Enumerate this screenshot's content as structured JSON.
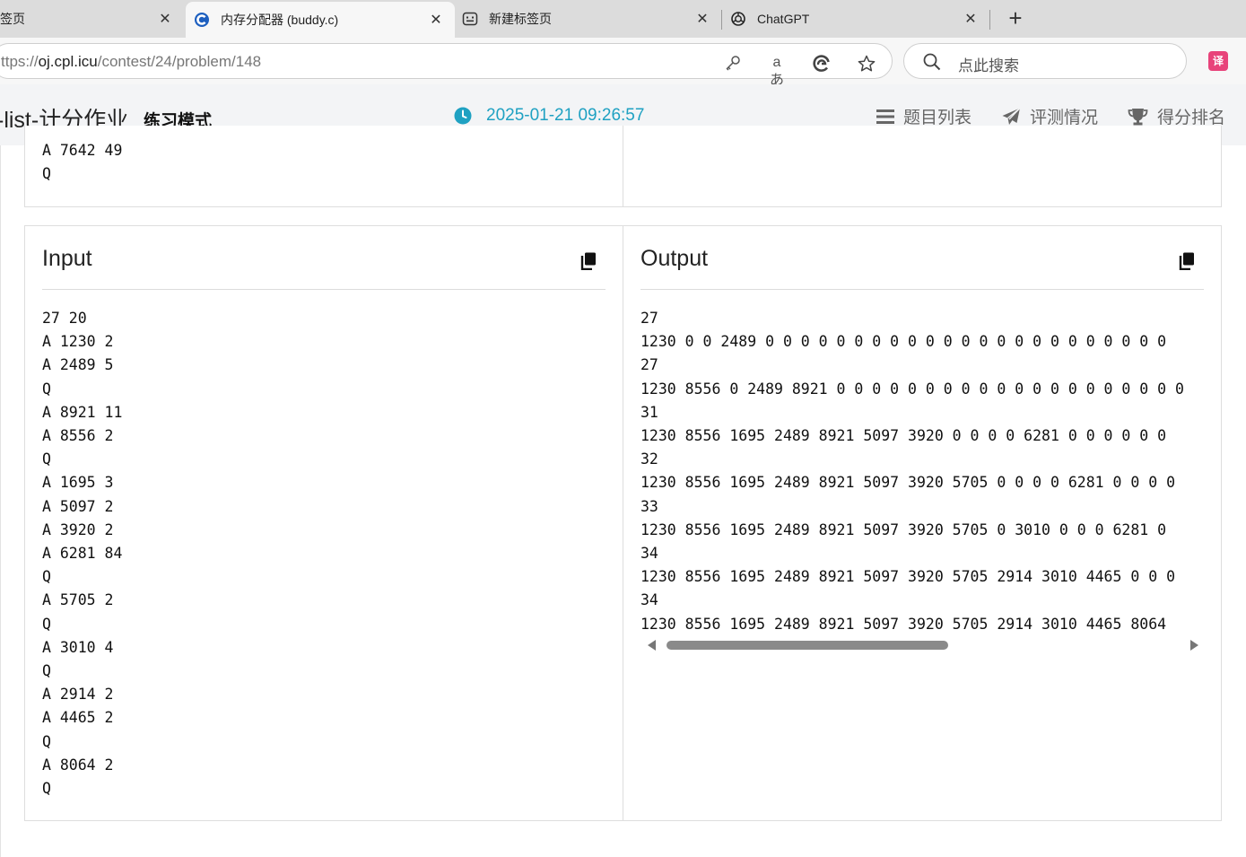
{
  "browser": {
    "tabs": [
      {
        "title": "签页",
        "icon": "page-icon"
      },
      {
        "title": "内存分配器 (buddy.c)",
        "icon": "oj-site-icon"
      },
      {
        "title": "新建标签页",
        "icon": "new-tab-page-icon"
      },
      {
        "title": "ChatGPT",
        "icon": "chatgpt-icon"
      }
    ],
    "tab_close_glyph": "✕",
    "new_tab_glyph": "+",
    "url_prefix": "ttps://",
    "url_host": "oj.cpl.icu",
    "url_path": "/contest/24/problem/148",
    "address_icons": [
      "key-icon",
      "read-aloud-icon",
      "edge-refresh-icon",
      "favorite-star-icon"
    ],
    "read_aloud_glyph": "aあ",
    "search_placeholder": "点此搜索",
    "extension_label": "译"
  },
  "header": {
    "contest_title": "-list-计分作业",
    "mode": "练习模式",
    "time": "2025-01-21 09:26:57",
    "nav": [
      {
        "label": "题目列表",
        "icon": "list-icon"
      },
      {
        "label": "评测情况",
        "icon": "paper-plane-icon"
      },
      {
        "label": "得分排名",
        "icon": "trophy-icon"
      }
    ],
    "accent_color": "#1fa1c2"
  },
  "previous_sample": {
    "input_tail": [
      "A 7642 49",
      "Q"
    ]
  },
  "sample": {
    "input_title": "Input",
    "output_title": "Output",
    "input_lines": [
      "27 20",
      "A 1230 2",
      "A 2489 5",
      "Q",
      "A 8921 11",
      "A 8556 2",
      "Q",
      "A 1695 3",
      "A 5097 2",
      "A 3920 2",
      "A 6281 84",
      "Q",
      "A 5705 2",
      "Q",
      "A 3010 4",
      "Q",
      "A 2914 2",
      "A 4465 2",
      "Q",
      "A 8064 2",
      "Q"
    ],
    "output_lines": [
      "27",
      "1230 0 0 2489 0 0 0 0 0 0 0 0 0 0 0 0 0 0 0 0 0 0 0 0 0 0 0",
      "27",
      "1230 8556 0 2489 8921 0 0 0 0 0 0 0 0 0 0 0 0 0 0 0 0 0 0 0 0",
      "31",
      "1230 8556 1695 2489 8921 5097 3920 0 0 0 0 6281 0 0 0 0 0 0",
      "32",
      "1230 8556 1695 2489 8921 5097 3920 5705 0 0 0 0 6281 0 0 0 0",
      "33",
      "1230 8556 1695 2489 8921 5097 3920 5705 0 3010 0 0 0 6281 0",
      "34",
      "1230 8556 1695 2489 8921 5097 3920 5705 2914 3010 4465 0 0 0",
      "34",
      "1230 8556 1695 2489 8921 5097 3920 5705 2914 3010 4465 8064"
    ],
    "copy_icon": "copy-icon"
  }
}
